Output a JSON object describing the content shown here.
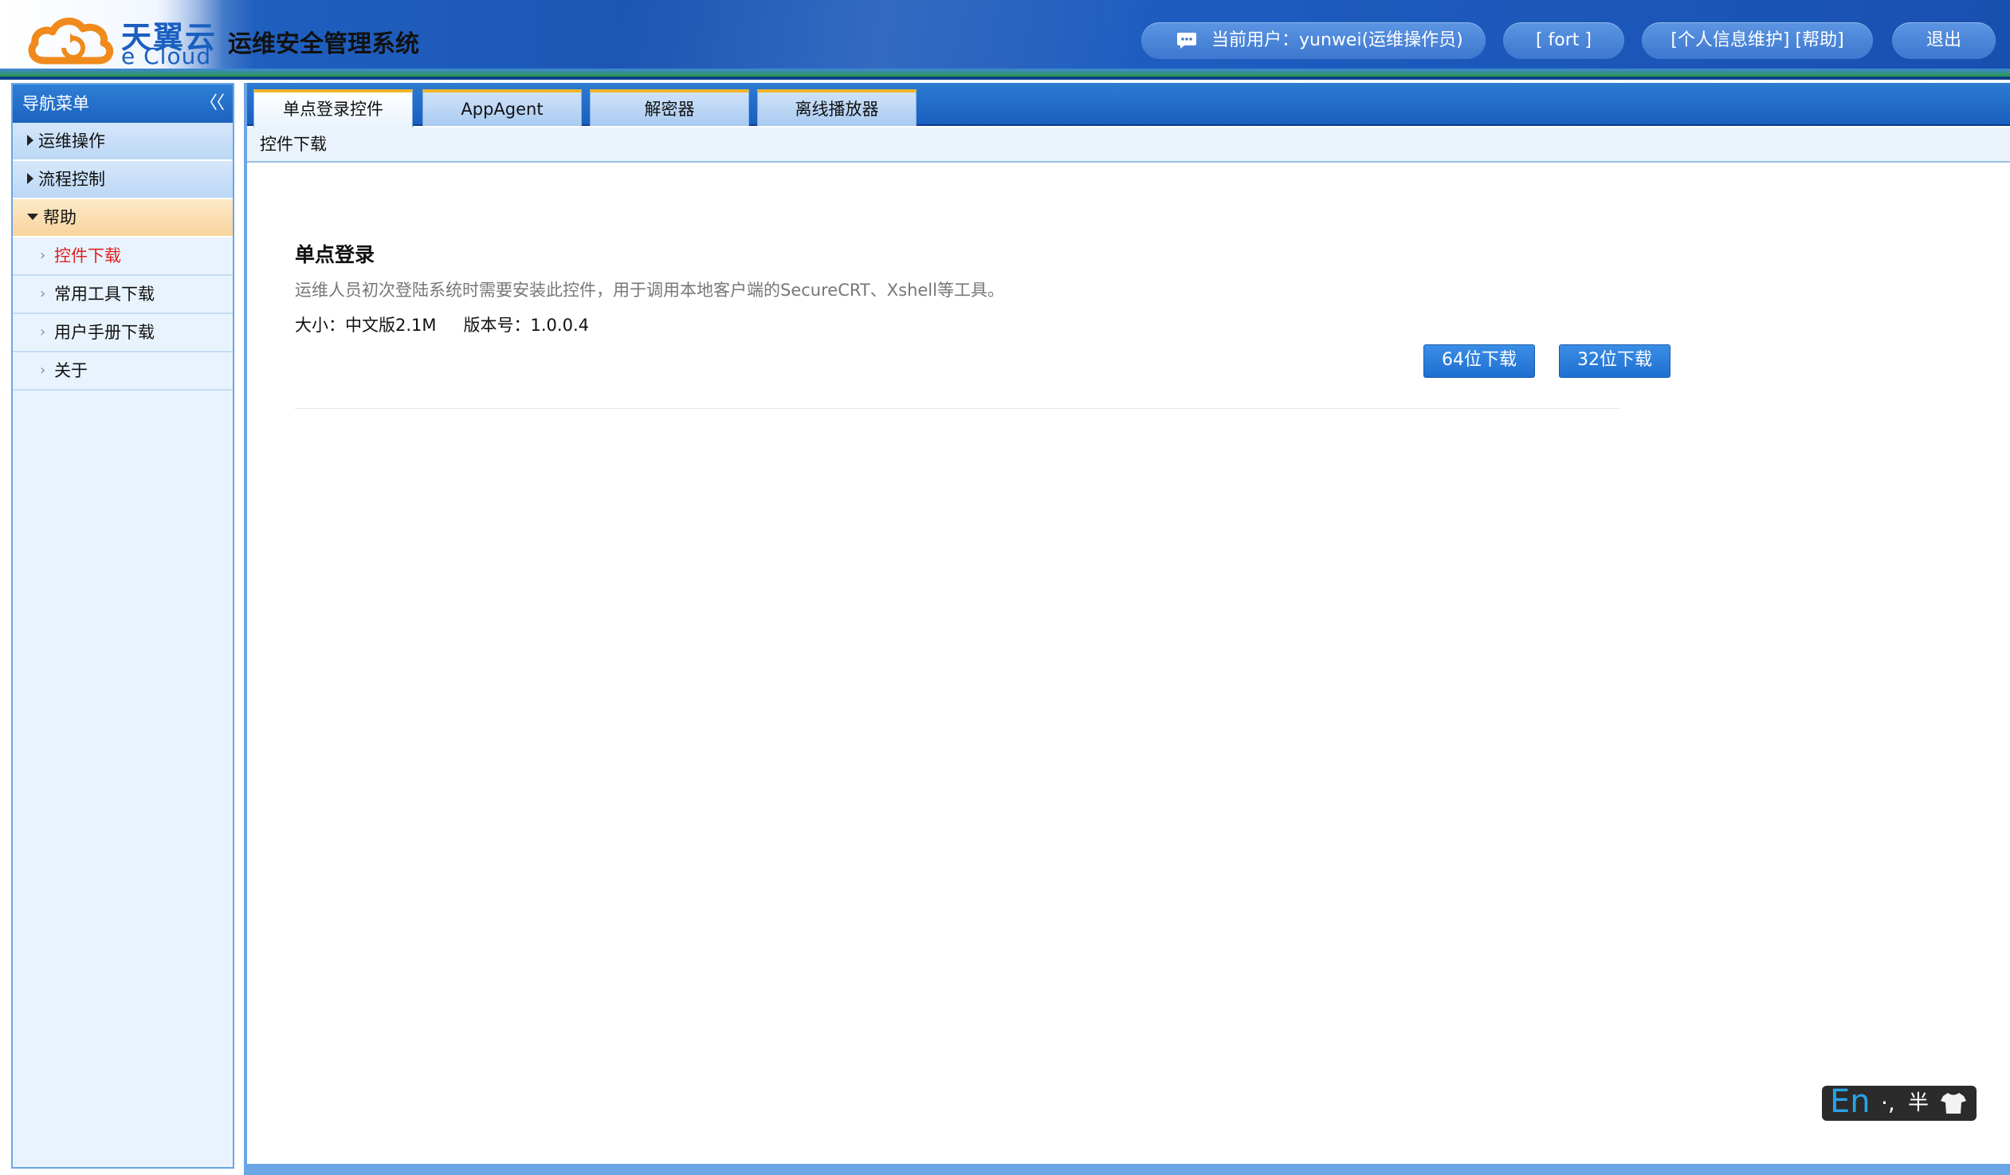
{
  "header": {
    "logo_cn": "天翼云",
    "logo_en": "e Cloud",
    "system_title": "运维安全管理系统",
    "current_user_label": "当前用户：",
    "current_user": "yunwei(运维操作员)",
    "fort_label": "[ fort ]",
    "profile_help_label": "[个人信息维护] [帮助]",
    "logout_label": "退出"
  },
  "sidebar": {
    "title": "导航菜单",
    "collapse_glyph": "〈〈",
    "groups": [
      {
        "label": "运维操作",
        "expanded": false
      },
      {
        "label": "流程控制",
        "expanded": false
      },
      {
        "label": "帮助",
        "expanded": true
      }
    ],
    "help_items": [
      {
        "label": "控件下载",
        "active": true
      },
      {
        "label": "常用工具下载",
        "active": false
      },
      {
        "label": "用户手册下载",
        "active": false
      },
      {
        "label": "关于",
        "active": false
      }
    ]
  },
  "tabs": [
    {
      "label": "单点登录控件",
      "active": true
    },
    {
      "label": "AppAgent",
      "active": false
    },
    {
      "label": "解密器",
      "active": false
    },
    {
      "label": "离线播放器",
      "active": false
    }
  ],
  "breadcrumb": "控件下载",
  "content": {
    "title": "单点登录",
    "description": "运维人员初次登陆系统时需要安装此控件，用于调用本地客户端的SecureCRT、Xshell等工具。",
    "size_text": "大小：中文版2.1M",
    "version_text": "版本号：1.0.0.4",
    "download_64_label": "64位下载",
    "download_32_label": "32位下载"
  },
  "ime": {
    "mode": "En",
    "punct": "·,",
    "width": "半",
    "skin_icon": "shirt-icon"
  },
  "colors": {
    "header_blue": "#1c56b4",
    "nav_blue": "#2f7fd6",
    "tab_accent": "#f0b429",
    "active_link": "#e02020",
    "button_blue": "#1f6fd0"
  }
}
